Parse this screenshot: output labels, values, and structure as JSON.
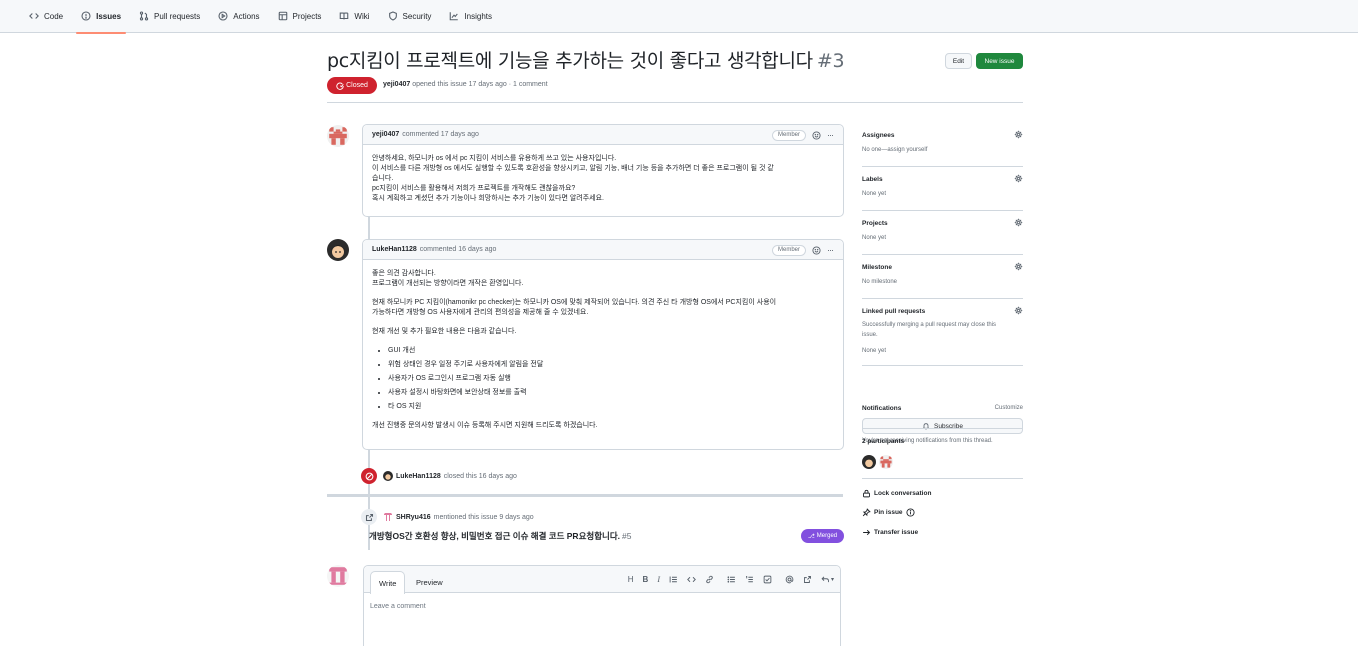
{
  "nav": {
    "code": "Code",
    "issues": "Issues",
    "pull_requests": "Pull requests",
    "actions": "Actions",
    "projects": "Projects",
    "wiki": "Wiki",
    "security": "Security",
    "insights": "Insights"
  },
  "issue": {
    "title": "pc지킴이 프로젝트에 기능을 추가하는 것이 좋다고 생각합니다",
    "number": "#3",
    "state": "Closed",
    "author": "yeji0407",
    "meta": "opened this issue 17 days ago · 1 comment"
  },
  "buttons": {
    "edit": "Edit",
    "new_issue": "New issue"
  },
  "comments": [
    {
      "author": "yeji0407",
      "time": "commented 17 days ago",
      "role": "Member",
      "body": [
        "안녕하세요, 하모니카 os 에서 pc 지킴이 서비스를 유용하게 쓰고 있는 사용자입니다.",
        "이 서비스를 다른 개방형 os 에서도 실행할 수 있도록 호환성을 향상시키고, 알림 기능, 배너 기능 등을 추가하면 더 좋은 프로그램이 될 것 같",
        "습니다.",
        "pc지킴이 서비스를 활용해서 저희가 프로젝트를 개작해도 괜찮을까요?",
        "혹시 계획하고 계셨던 추가 기능이나 희망하시는 추가 기능이 있다면 알려주세요."
      ]
    },
    {
      "author": "LukeHan1128",
      "time": "commented 16 days ago",
      "role": "Member",
      "p1": [
        "좋은 의견 감사합니다.",
        "프로그램이 개선되는 방향이라면 개작은 환영입니다."
      ],
      "p2": [
        "현재 하모니카 PC 지킴이(hamonikr pc checker)는 하모니카 OS에 맞춰 제작되어 있습니다. 의견 주신 타 개방형 OS에서 PC지킴이 사용이",
        "가능하다면 개방형 OS 사용자에게 관리의 편의성을 제공해 줄 수 있겠네요."
      ],
      "p3": "현재 개선 및 추가 필요한 내용은 다음과 같습니다.",
      "list": [
        "GUI 개선",
        "위험 상태인 경우 일정 주기로 사용자에게 알림을 전달",
        "사용자가 OS 로그인시 프로그램 자동 실행",
        "사용자 설정시 바탕화면에 보안상태 정보를 출력",
        "타 OS 지원"
      ],
      "p4": "개선 진행중 문의사항 발생시 이슈 등록해 주시면 지원해 드리도록 하겠습니다."
    }
  ],
  "closed_event": {
    "actor": "LukeHan1128",
    "text": "closed this 16 days ago"
  },
  "mention_event": {
    "actor": "SHRyu416",
    "text": "mentioned this issue 9 days ago",
    "ref_title": "개방형OS간 호환성 향상, 비밀번호 접근 이슈 해결 코드 PR요청합니다.",
    "ref_number": "#5",
    "ref_state": "Merged"
  },
  "composer": {
    "tab_write": "Write",
    "tab_preview": "Preview",
    "placeholder": "Leave a comment",
    "tools": [
      "H",
      "B",
      "I"
    ]
  },
  "sidebar": {
    "assignees": {
      "title": "Assignees",
      "value": "No one—assign yourself"
    },
    "labels": {
      "title": "Labels",
      "value": "None yet"
    },
    "projects": {
      "title": "Projects",
      "value": "None yet"
    },
    "milestone": {
      "title": "Milestone",
      "value": "No milestone"
    },
    "linked_prs": {
      "title": "Linked pull requests",
      "desc1": "Successfully merging a pull request may close this",
      "desc2": "issue.",
      "value": "None yet"
    },
    "notifications": {
      "title": "Notifications",
      "customize": "Customize",
      "subscribe": "Subscribe",
      "note": "You're not receiving notifications from this thread."
    },
    "participants": {
      "title": "2 participants"
    },
    "lock": "Lock conversation",
    "pin": "Pin issue",
    "transfer": "Transfer issue"
  }
}
